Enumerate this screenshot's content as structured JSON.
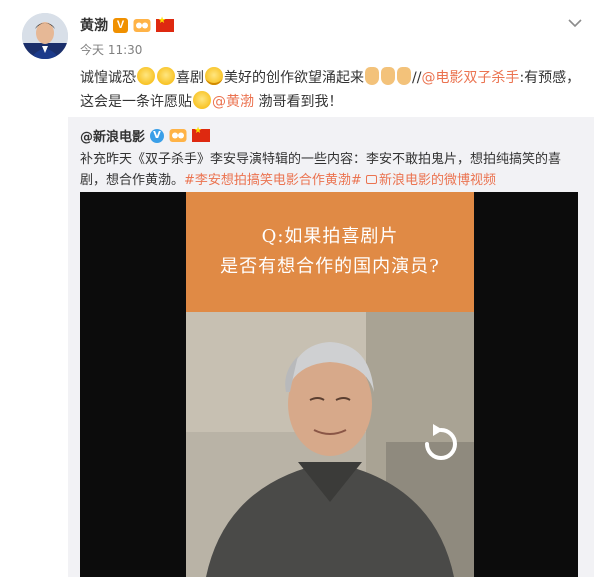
{
  "post": {
    "author": "黄渤",
    "verified_badge": "V",
    "time": "今天 11:30",
    "text": {
      "p1": "诚惶诚恐",
      "p2": "喜剧",
      "p3": "美好的创作欲望涌起来",
      "p4": "//",
      "mention_movie": "@电影双子杀手",
      "p5": ":有预感，",
      "p6": "这会是一条许愿贴",
      "mention_self": "@黄渤",
      "p7": " 渤哥看到我！"
    }
  },
  "repost": {
    "author": "@新浪电影",
    "text_main": "补充昨天《双子杀手》李安导演特辑的一些内容：李安不敢拍鬼片，想拍纯搞笑的喜剧，想合作黄渤。",
    "hashtag": "#李安想拍搞笑电影合作黄渤#",
    "video_link": "新浪电影的微博视频"
  },
  "video": {
    "caption_line1": "Q:如果拍喜剧片",
    "caption_line2": "是否有想合作的国内演员?"
  },
  "colors": {
    "link": "#eb7350",
    "repost_bg": "#f2f2f5",
    "caption_bg": "#e08a45"
  },
  "icons": [
    "chevron-down-icon",
    "replay-icon",
    "video-icon"
  ]
}
